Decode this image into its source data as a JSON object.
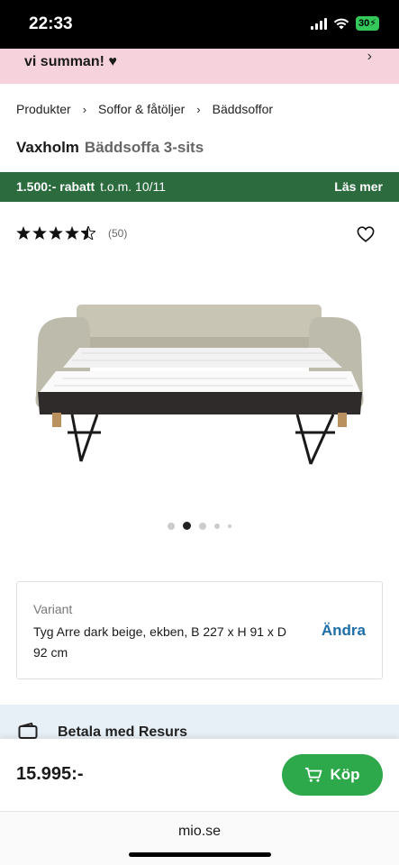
{
  "status_bar": {
    "time": "22:33",
    "battery": "30"
  },
  "promo": {
    "text": "vi summan! ♥",
    "chevron": "›"
  },
  "breadcrumb": {
    "items": [
      "Produkter",
      "Soffor & fåtöljer",
      "Bäddsoffor"
    ],
    "separator": "›"
  },
  "product": {
    "brand": "Vaxholm",
    "model": "Bäddsoffa 3-sits"
  },
  "discount": {
    "amount": "1.500:- rabatt",
    "period": "t.o.m. 10/11",
    "read_more": "Läs mer",
    "color": "#2b6b3e"
  },
  "rating": {
    "stars": 4.5,
    "max": 5,
    "count": "(50)"
  },
  "gallery": {
    "current_index": 1,
    "total": 5
  },
  "variant": {
    "label": "Variant",
    "value": "Tyg Arre dark beige, ekben, B 227 x H 91 x D 92 cm",
    "change": "Ändra"
  },
  "payment": {
    "text": "Betala med Resurs",
    "icon": "wallet-icon"
  },
  "purchase": {
    "price": "15.995:-",
    "buy_label": "Köp",
    "button_color": "#2da84a"
  },
  "browser": {
    "url": "mio.se"
  },
  "colors": {
    "promo_bg": "#f6d3dc",
    "accent_blue": "#1e6ea7",
    "resurs_bg": "#e8f0f7"
  }
}
